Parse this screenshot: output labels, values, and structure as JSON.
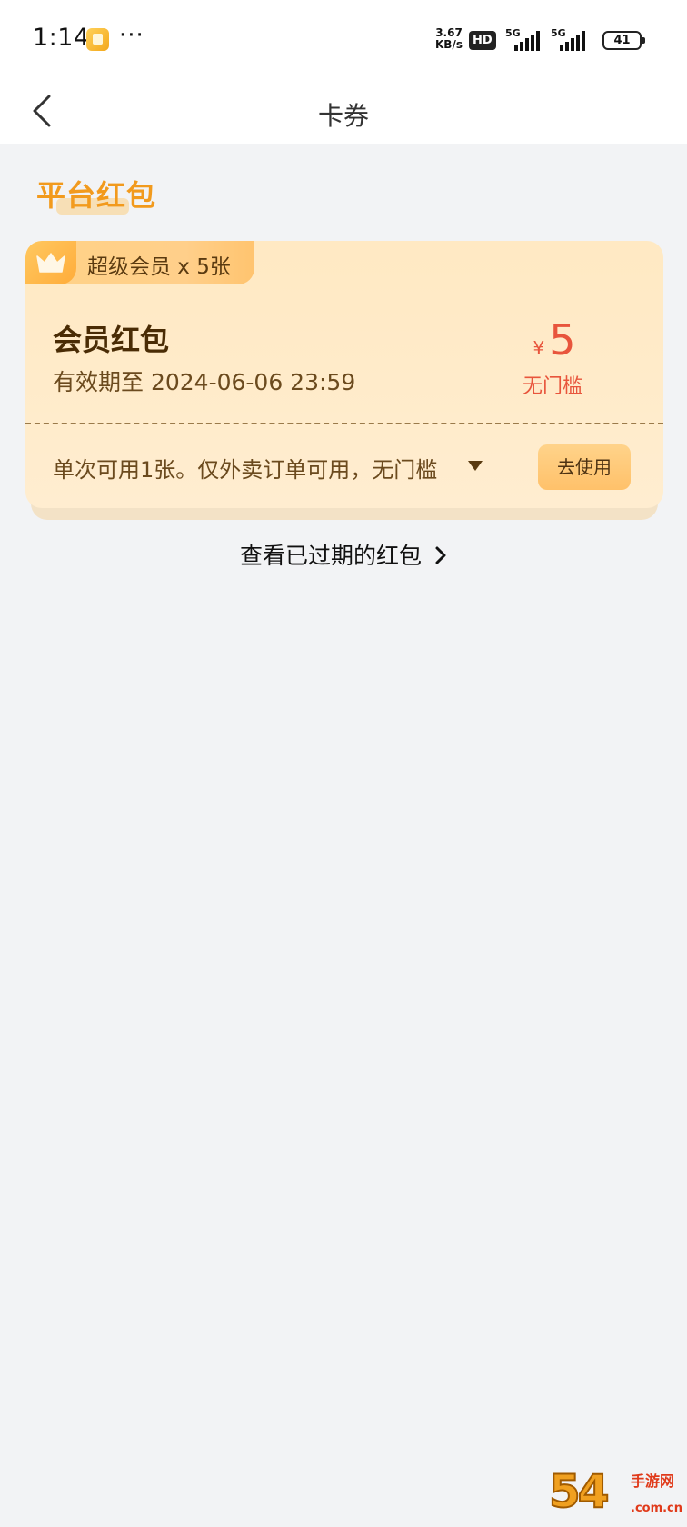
{
  "status_bar": {
    "time": "1:14",
    "more": "···",
    "net_speed": "3.67",
    "net_unit": "KB/s",
    "hd_badge": "HD",
    "signal1_tag": "5G",
    "signal2_tag": "5G",
    "battery": "41"
  },
  "header": {
    "title": "卡券"
  },
  "section": {
    "title": "平台红包"
  },
  "coupon": {
    "tag_label": "超级会员 x 5张",
    "name": "会员红包",
    "validity": "有效期至 2024-06-06 23:59",
    "currency": "¥",
    "amount": "5",
    "threshold": "无门槛",
    "rule": "单次可用1张。仅外卖订单可用，无门槛",
    "use_label": "去使用"
  },
  "expired_link": {
    "label": "查看已过期的红包"
  },
  "watermark": {
    "main": "54",
    "side": "手游网",
    "domain": ".com.cn"
  },
  "colors": {
    "accent_orange": "#f29a1d",
    "amount_red": "#e8553c",
    "card_bg": "#ffe9c3",
    "page_bg": "#f2f3f5"
  }
}
